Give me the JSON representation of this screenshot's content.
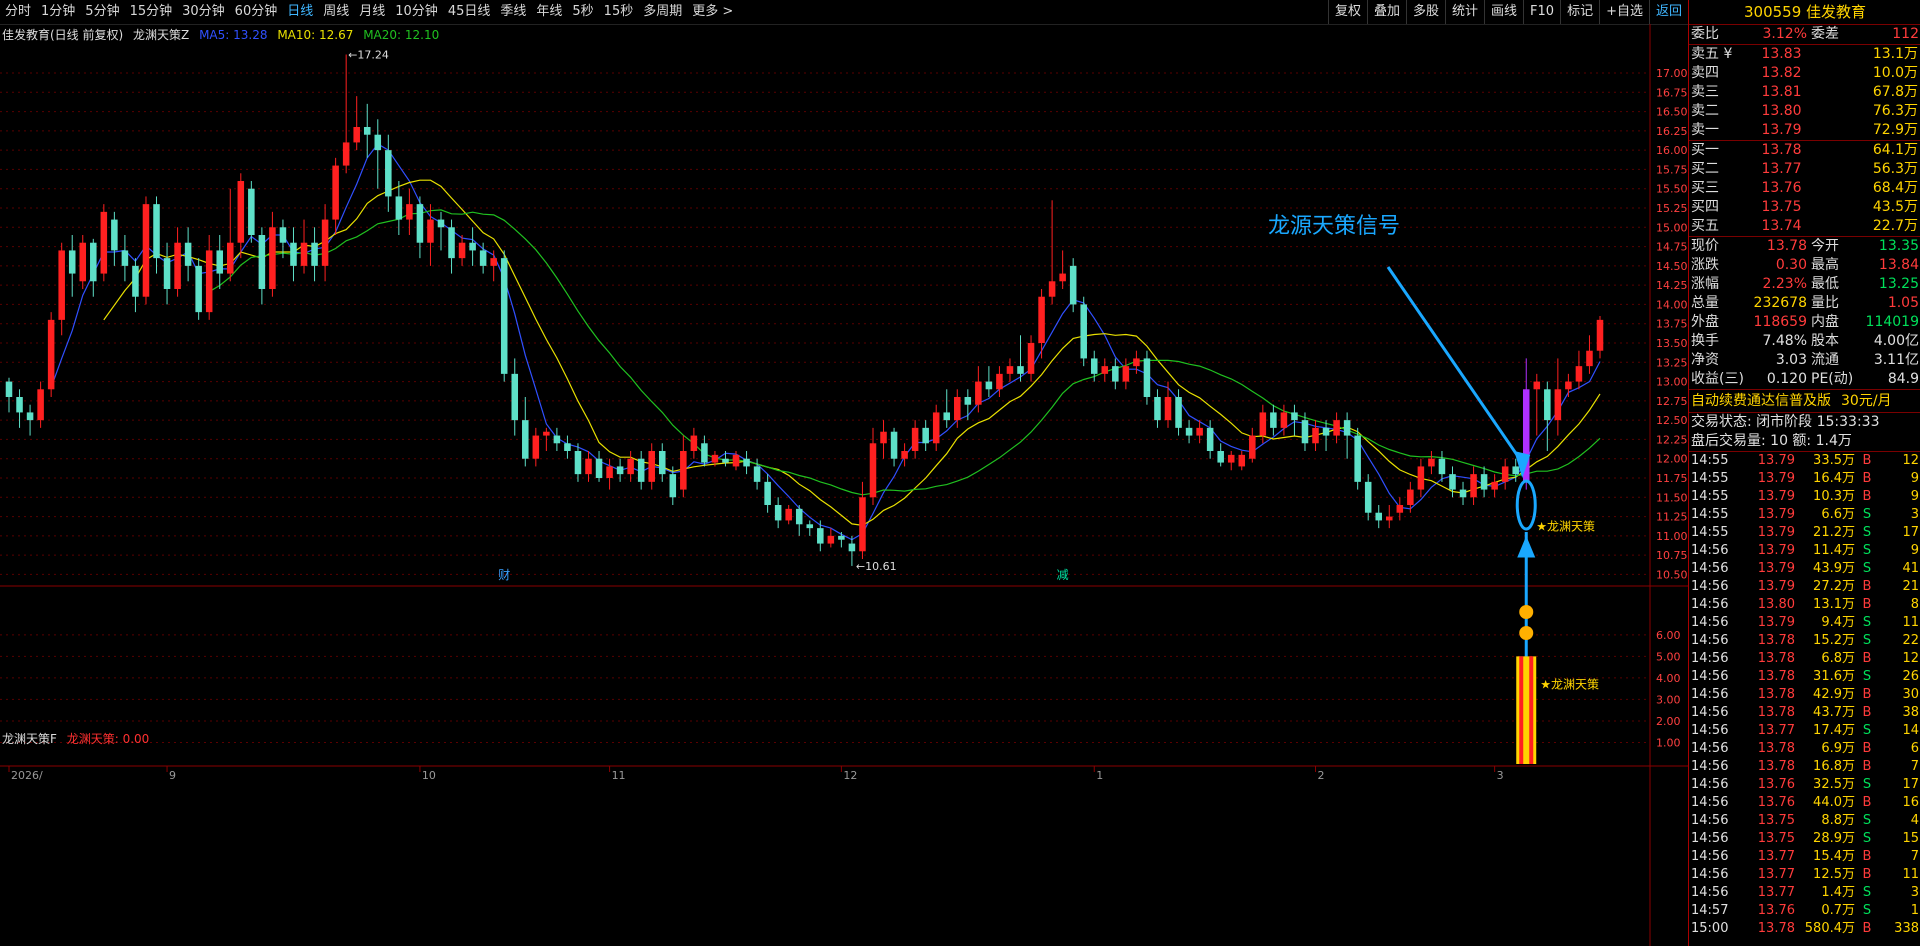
{
  "toolbar": {
    "periods": [
      "分时",
      "1分钟",
      "5分钟",
      "15分钟",
      "30分钟",
      "60分钟",
      "日线",
      "周线",
      "月线",
      "10分钟",
      "45日线",
      "季线",
      "年线",
      "5秒",
      "15秒",
      "多周期",
      "更多 >"
    ],
    "active_index": 6,
    "buttons": [
      "复权",
      "叠加",
      "多股",
      "统计",
      "画线",
      "F10",
      "标记",
      "+自选",
      "返回"
    ]
  },
  "main_legend": {
    "stock": "佳发教育(日线 前复权)",
    "indicator": "龙渊天策Z",
    "ma5": "MA5: 13.28",
    "ma10": "MA10: 12.67",
    "ma20": "MA20: 12.10"
  },
  "sub_legend": {
    "name": "龙渊天策F",
    "value": "龙渊天策: 0.00"
  },
  "annotations": {
    "high": "17.24",
    "low": "10.61",
    "signal_title": "龙源天策信号",
    "signal_label": "★龙渊天策",
    "marker_cai": "财",
    "marker_jian": "减",
    "sub_signal_label": "★龙渊天策"
  },
  "x_axis_labels": [
    "2026/",
    "9",
    "10",
    "11",
    "12",
    "1",
    "2",
    "3"
  ],
  "colors": {
    "up": "#ff2020",
    "down": "#5ee0c8",
    "ma5": "#3050ff",
    "ma10": "#e8e000",
    "ma20": "#20c020",
    "grid": "#5a0000",
    "arrow": "#1aa8ff"
  },
  "chart_data": {
    "type": "candlestick",
    "y_ticks": [
      "17.00",
      "16.75",
      "16.50",
      "16.25",
      "16.00",
      "15.75",
      "15.50",
      "15.25",
      "15.00",
      "14.75",
      "14.50",
      "14.25",
      "14.00",
      "13.75",
      "13.50",
      "13.25",
      "13.00",
      "12.75",
      "12.50",
      "12.25",
      "12.00",
      "11.75",
      "11.50",
      "11.25",
      "11.00",
      "10.75",
      "10.50"
    ],
    "ylim": [
      10.35,
      17.35
    ],
    "sub_y_ticks": [
      "6.00",
      "5.00",
      "4.00",
      "3.00",
      "2.00",
      "1.00"
    ],
    "sub_ylim": [
      0,
      7.2
    ],
    "candles": [
      [
        13.0,
        12.8,
        13.05,
        12.6
      ],
      [
        12.8,
        12.6,
        12.9,
        12.4
      ],
      [
        12.6,
        12.5,
        12.7,
        12.3
      ],
      [
        12.5,
        12.9,
        13.0,
        12.4
      ],
      [
        12.9,
        13.8,
        13.9,
        12.8
      ],
      [
        13.8,
        14.7,
        14.8,
        13.6
      ],
      [
        14.7,
        14.4,
        14.9,
        14.1
      ],
      [
        14.3,
        14.8,
        14.9,
        14.2
      ],
      [
        14.8,
        14.3,
        14.85,
        14.1
      ],
      [
        14.4,
        15.2,
        15.3,
        14.3
      ],
      [
        15.1,
        14.7,
        15.2,
        14.5
      ],
      [
        14.7,
        14.5,
        14.9,
        14.3
      ],
      [
        14.5,
        14.1,
        14.6,
        13.9
      ],
      [
        14.1,
        15.3,
        15.4,
        14.0
      ],
      [
        15.3,
        14.6,
        15.4,
        14.4
      ],
      [
        14.6,
        14.2,
        14.8,
        14.0
      ],
      [
        14.2,
        14.8,
        15.0,
        14.1
      ],
      [
        14.8,
        14.5,
        15.0,
        14.3
      ],
      [
        14.5,
        13.9,
        14.6,
        13.8
      ],
      [
        13.9,
        14.7,
        14.9,
        13.8
      ],
      [
        14.7,
        14.4,
        14.9,
        14.2
      ],
      [
        14.4,
        14.8,
        15.5,
        14.3
      ],
      [
        14.8,
        15.6,
        15.7,
        14.6
      ],
      [
        15.5,
        14.9,
        15.6,
        14.8
      ],
      [
        14.9,
        14.2,
        15.0,
        14.0
      ],
      [
        14.2,
        15.0,
        15.2,
        14.1
      ],
      [
        15.0,
        14.8,
        15.1,
        14.6
      ],
      [
        14.8,
        14.5,
        15.0,
        14.3
      ],
      [
        14.5,
        14.8,
        15.1,
        14.4
      ],
      [
        14.8,
        14.5,
        15.0,
        14.3
      ],
      [
        14.5,
        15.1,
        15.3,
        14.3
      ],
      [
        15.1,
        15.8,
        15.9,
        14.9
      ],
      [
        15.8,
        16.1,
        17.24,
        15.7
      ],
      [
        16.1,
        16.3,
        16.7,
        16.0
      ],
      [
        16.3,
        16.2,
        16.6,
        15.9
      ],
      [
        16.2,
        16.0,
        16.4,
        15.5
      ],
      [
        16.0,
        15.4,
        16.2,
        15.2
      ],
      [
        15.4,
        15.1,
        15.6,
        14.9
      ],
      [
        15.1,
        15.3,
        15.5,
        14.9
      ],
      [
        15.3,
        14.8,
        15.4,
        14.6
      ],
      [
        14.8,
        15.1,
        15.3,
        14.5
      ],
      [
        15.1,
        15.0,
        15.2,
        14.7
      ],
      [
        15.0,
        14.6,
        15.1,
        14.4
      ],
      [
        14.6,
        14.8,
        14.9,
        14.5
      ],
      [
        14.8,
        14.7,
        15.0,
        14.5
      ],
      [
        14.7,
        14.5,
        14.8,
        14.4
      ],
      [
        14.5,
        14.6,
        14.7,
        14.3
      ],
      [
        14.6,
        13.1,
        14.7,
        13.0
      ],
      [
        13.1,
        12.5,
        13.3,
        12.3
      ],
      [
        12.5,
        12.0,
        12.8,
        11.9
      ],
      [
        12.0,
        12.3,
        12.4,
        11.9
      ],
      [
        12.3,
        12.35,
        12.4,
        12.1
      ],
      [
        12.3,
        12.2,
        12.4,
        12.1
      ],
      [
        12.2,
        12.1,
        12.3,
        12.0
      ],
      [
        12.1,
        11.8,
        12.2,
        11.7
      ],
      [
        11.8,
        12.0,
        12.1,
        11.7
      ],
      [
        12.0,
        11.75,
        12.1,
        11.7
      ],
      [
        11.75,
        11.9,
        12.0,
        11.6
      ],
      [
        11.9,
        11.8,
        12.0,
        11.7
      ],
      [
        11.8,
        12.0,
        12.1,
        11.7
      ],
      [
        12.0,
        11.7,
        12.1,
        11.6
      ],
      [
        11.7,
        12.1,
        12.2,
        11.6
      ],
      [
        12.1,
        11.8,
        12.2,
        11.7
      ],
      [
        11.8,
        11.5,
        11.9,
        11.4
      ],
      [
        11.6,
        12.1,
        12.3,
        11.5
      ],
      [
        12.1,
        12.3,
        12.4,
        12.0
      ],
      [
        12.2,
        11.95,
        12.3,
        11.9
      ],
      [
        11.95,
        12.05,
        12.1,
        11.9
      ],
      [
        12.0,
        11.95,
        12.1,
        11.9
      ],
      [
        11.9,
        12.05,
        12.1,
        11.85
      ],
      [
        12.0,
        11.9,
        12.1,
        11.8
      ],
      [
        11.9,
        11.7,
        12.0,
        11.6
      ],
      [
        11.7,
        11.4,
        11.8,
        11.3
      ],
      [
        11.4,
        11.2,
        11.5,
        11.1
      ],
      [
        11.2,
        11.35,
        11.4,
        11.15
      ],
      [
        11.35,
        11.15,
        11.4,
        11.0
      ],
      [
        11.15,
        11.1,
        11.2,
        11.0
      ],
      [
        11.1,
        10.9,
        11.2,
        10.8
      ],
      [
        10.9,
        11.0,
        11.1,
        10.85
      ],
      [
        11.0,
        10.95,
        11.05,
        10.85
      ],
      [
        10.9,
        10.8,
        11.0,
        10.61
      ],
      [
        10.8,
        11.5,
        11.7,
        10.7
      ],
      [
        11.5,
        12.2,
        12.4,
        11.4
      ],
      [
        12.2,
        12.35,
        12.5,
        12.0
      ],
      [
        12.35,
        12.0,
        12.4,
        11.9
      ],
      [
        12.0,
        12.1,
        12.2,
        11.9
      ],
      [
        12.1,
        12.4,
        12.5,
        12.0
      ],
      [
        12.4,
        12.2,
        12.5,
        12.1
      ],
      [
        12.2,
        12.6,
        12.7,
        12.1
      ],
      [
        12.6,
        12.5,
        12.9,
        12.4
      ],
      [
        12.5,
        12.8,
        12.9,
        12.4
      ],
      [
        12.8,
        12.7,
        12.9,
        12.5
      ],
      [
        12.7,
        13.0,
        13.2,
        12.6
      ],
      [
        13.0,
        12.9,
        13.2,
        12.8
      ],
      [
        12.9,
        13.1,
        13.2,
        12.8
      ],
      [
        13.1,
        13.2,
        13.3,
        13.0
      ],
      [
        13.2,
        13.1,
        13.6,
        13.0
      ],
      [
        13.1,
        13.5,
        13.6,
        13.0
      ],
      [
        13.5,
        14.1,
        14.2,
        13.3
      ],
      [
        14.1,
        14.3,
        15.35,
        14.0
      ],
      [
        14.3,
        14.4,
        14.7,
        14.2
      ],
      [
        14.5,
        14.0,
        14.6,
        13.9
      ],
      [
        14.0,
        13.3,
        14.1,
        13.2
      ],
      [
        13.3,
        13.1,
        13.4,
        13.0
      ],
      [
        13.1,
        13.2,
        13.3,
        13.0
      ],
      [
        13.2,
        13.0,
        13.3,
        12.9
      ],
      [
        13.0,
        13.2,
        13.3,
        12.9
      ],
      [
        13.2,
        13.3,
        13.4,
        13.1
      ],
      [
        13.3,
        12.8,
        13.4,
        12.7
      ],
      [
        12.8,
        12.5,
        12.9,
        12.4
      ],
      [
        12.5,
        12.8,
        13.0,
        12.4
      ],
      [
        12.8,
        12.4,
        12.9,
        12.3
      ],
      [
        12.4,
        12.3,
        12.5,
        12.2
      ],
      [
        12.3,
        12.4,
        12.5,
        12.2
      ],
      [
        12.4,
        12.1,
        12.5,
        12.0
      ],
      [
        12.1,
        11.95,
        12.2,
        11.9
      ],
      [
        11.95,
        12.05,
        12.1,
        11.85
      ],
      [
        11.9,
        12.05,
        12.1,
        11.85
      ],
      [
        12.0,
        12.3,
        12.4,
        11.95
      ],
      [
        12.3,
        12.6,
        12.7,
        12.2
      ],
      [
        12.6,
        12.4,
        12.7,
        12.3
      ],
      [
        12.4,
        12.6,
        12.7,
        12.3
      ],
      [
        12.6,
        12.5,
        12.7,
        12.3
      ],
      [
        12.5,
        12.2,
        12.6,
        12.1
      ],
      [
        12.2,
        12.4,
        12.5,
        12.1
      ],
      [
        12.4,
        12.3,
        12.5,
        12.1
      ],
      [
        12.3,
        12.5,
        12.6,
        12.2
      ],
      [
        12.5,
        12.3,
        12.6,
        12.0
      ],
      [
        12.3,
        11.7,
        12.4,
        11.6
      ],
      [
        11.7,
        11.3,
        11.8,
        11.2
      ],
      [
        11.3,
        11.2,
        11.4,
        11.1
      ],
      [
        11.2,
        11.25,
        11.4,
        11.1
      ],
      [
        11.3,
        11.4,
        11.5,
        11.2
      ],
      [
        11.4,
        11.6,
        11.7,
        11.3
      ],
      [
        11.6,
        11.9,
        12.0,
        11.5
      ],
      [
        11.9,
        12.0,
        12.1,
        11.8
      ],
      [
        12.0,
        11.8,
        12.1,
        11.7
      ],
      [
        11.8,
        11.6,
        11.9,
        11.5
      ],
      [
        11.6,
        11.5,
        11.7,
        11.4
      ],
      [
        11.5,
        11.8,
        11.9,
        11.4
      ],
      [
        11.8,
        11.6,
        11.9,
        11.5
      ],
      [
        11.6,
        11.7,
        11.8,
        11.5
      ],
      [
        11.7,
        11.9,
        12.0,
        11.6
      ],
      [
        11.9,
        11.8,
        12.0,
        11.7
      ],
      [
        11.7,
        12.9,
        13.3,
        11.6
      ],
      [
        12.9,
        13.0,
        13.1,
        12.3
      ],
      [
        12.9,
        12.5,
        13.0,
        12.1
      ],
      [
        12.5,
        12.9,
        13.3,
        12.3
      ],
      [
        12.9,
        13.0,
        13.1,
        12.8
      ],
      [
        13.0,
        13.2,
        13.4,
        12.9
      ],
      [
        13.2,
        13.4,
        13.6,
        13.1
      ],
      [
        13.4,
        13.8,
        13.85,
        13.3
      ]
    ],
    "signal_index": 144,
    "sub_bar_value": 5.0
  },
  "right_panel": {
    "title": "300559 佳发教育",
    "weibi": {
      "l1": "委比",
      "v1": "3.12%",
      "l2": "委差",
      "v2": "112"
    },
    "asks": [
      {
        "label": "卖五 ¥",
        "price": "13.83",
        "vol": "13.1万"
      },
      {
        "label": "卖四",
        "price": "13.82",
        "vol": "10.0万"
      },
      {
        "label": "卖三",
        "price": "13.81",
        "vol": "67.8万"
      },
      {
        "label": "卖二",
        "price": "13.80",
        "vol": "76.3万"
      },
      {
        "label": "卖一",
        "price": "13.79",
        "vol": "72.9万"
      }
    ],
    "bids": [
      {
        "label": "买一",
        "price": "13.78",
        "vol": "64.1万"
      },
      {
        "label": "买二",
        "price": "13.77",
        "vol": "56.3万"
      },
      {
        "label": "买三",
        "price": "13.76",
        "vol": "68.4万"
      },
      {
        "label": "买四",
        "price": "13.75",
        "vol": "43.5万"
      },
      {
        "label": "买五",
        "price": "13.74",
        "vol": "22.7万"
      }
    ],
    "quote": [
      {
        "l1": "现价",
        "v1": "13.78",
        "c1": "red",
        "l2": "今开",
        "v2": "13.35",
        "c2": "grn"
      },
      {
        "l1": "涨跌",
        "v1": "0.30",
        "c1": "red",
        "l2": "最高",
        "v2": "13.84",
        "c2": "red"
      },
      {
        "l1": "涨幅",
        "v1": "2.23%",
        "c1": "red",
        "l2": "最低",
        "v2": "13.25",
        "c2": "grn"
      },
      {
        "l1": "总量",
        "v1": "232678",
        "c1": "yel",
        "l2": "量比",
        "v2": "1.05",
        "c2": "red"
      },
      {
        "l1": "外盘",
        "v1": "118659",
        "c1": "red",
        "l2": "内盘",
        "v2": "114019",
        "c2": "grn"
      },
      {
        "l1": "换手",
        "v1": "7.48%",
        "c1": "wht",
        "l2": "股本",
        "v2": "4.00亿",
        "c2": "wht"
      },
      {
        "l1": "净资",
        "v1": "3.03",
        "c1": "wht",
        "l2": "流通",
        "v2": "3.11亿",
        "c2": "wht"
      },
      {
        "l1": "收益(三)",
        "v1": "0.120",
        "c1": "wht",
        "l2": "PE(动)",
        "v2": "84.9",
        "c2": "wht"
      }
    ],
    "promo": "自动续费通达信普及版",
    "promo_price": "30元/月",
    "status": "交易状态: 闭市阶段 15:33:33",
    "after": "盘后交易量: 10  额: 1.4万",
    "trades": [
      [
        "14:55",
        "13.79",
        "33.5万",
        "B",
        "12"
      ],
      [
        "14:55",
        "13.79",
        "16.4万",
        "B",
        "9"
      ],
      [
        "14:55",
        "13.79",
        "10.3万",
        "B",
        "9"
      ],
      [
        "14:55",
        "13.79",
        "6.6万",
        "S",
        "3"
      ],
      [
        "14:55",
        "13.79",
        "21.2万",
        "S",
        "17"
      ],
      [
        "14:56",
        "13.79",
        "11.4万",
        "S",
        "9"
      ],
      [
        "14:56",
        "13.79",
        "43.9万",
        "S",
        "41"
      ],
      [
        "14:56",
        "13.79",
        "27.2万",
        "B",
        "21"
      ],
      [
        "14:56",
        "13.80",
        "13.1万",
        "B",
        "8"
      ],
      [
        "14:56",
        "13.79",
        "9.4万",
        "S",
        "11"
      ],
      [
        "14:56",
        "13.78",
        "15.2万",
        "S",
        "22"
      ],
      [
        "14:56",
        "13.78",
        "6.8万",
        "B",
        "12"
      ],
      [
        "14:56",
        "13.78",
        "31.6万",
        "S",
        "26"
      ],
      [
        "14:56",
        "13.78",
        "42.9万",
        "B",
        "30"
      ],
      [
        "14:56",
        "13.78",
        "43.7万",
        "B",
        "38"
      ],
      [
        "14:56",
        "13.77",
        "17.4万",
        "S",
        "14"
      ],
      [
        "14:56",
        "13.78",
        "6.9万",
        "B",
        "6"
      ],
      [
        "14:56",
        "13.78",
        "16.8万",
        "B",
        "7"
      ],
      [
        "14:56",
        "13.76",
        "32.5万",
        "S",
        "17"
      ],
      [
        "14:56",
        "13.76",
        "44.0万",
        "B",
        "16"
      ],
      [
        "14:56",
        "13.75",
        "8.8万",
        "S",
        "4"
      ],
      [
        "14:56",
        "13.75",
        "28.9万",
        "S",
        "15"
      ],
      [
        "14:56",
        "13.77",
        "15.4万",
        "B",
        "7"
      ],
      [
        "14:56",
        "13.77",
        "12.5万",
        "B",
        "11"
      ],
      [
        "14:56",
        "13.77",
        "1.4万",
        "S",
        "3"
      ],
      [
        "14:57",
        "13.76",
        "0.7万",
        "S",
        "1"
      ],
      [
        "15:00",
        "13.78",
        "580.4万",
        "B",
        "338"
      ]
    ]
  }
}
